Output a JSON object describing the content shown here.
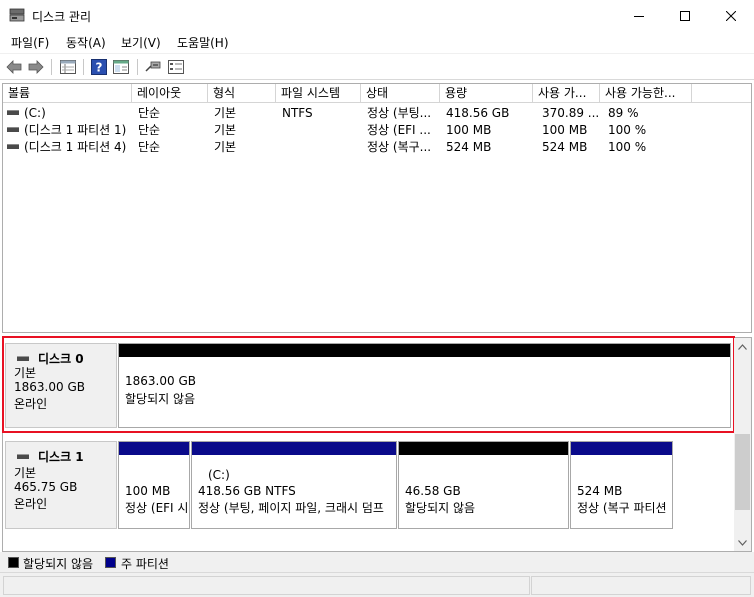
{
  "window": {
    "title": "디스크 관리",
    "controls": [
      "minimize-icon",
      "maximize-icon",
      "close-icon"
    ]
  },
  "menu": {
    "items": [
      {
        "label": "파일(F)"
      },
      {
        "label": "동작(A)"
      },
      {
        "label": "보기(V)"
      },
      {
        "label": "도움말(H)"
      }
    ]
  },
  "toolbar": {
    "icons": [
      "back-arrow-icon",
      "forward-arrow-icon",
      "volume-list-icon",
      "help-icon",
      "console-tree-icon",
      "connect-icon",
      "properties-icon"
    ]
  },
  "volume_table": {
    "columns": [
      "볼륨",
      "레이아웃",
      "형식",
      "파일 시스템",
      "상태",
      "용량",
      "사용 가...",
      "사용 가능한..."
    ],
    "rows": [
      {
        "volume": "(C:)",
        "layout": "단순",
        "type": "기본",
        "fs": "NTFS",
        "status": "정상 (부팅...",
        "capacity": "418.56 GB",
        "free": "370.89 ...",
        "pct": "89 %"
      },
      {
        "volume": "(디스크 1 파티션 1)",
        "layout": "단순",
        "type": "기본",
        "fs": "",
        "status": "정상 (EFI ...",
        "capacity": "100 MB",
        "free": "100 MB",
        "pct": "100 %"
      },
      {
        "volume": "(디스크 1 파티션 4)",
        "layout": "단순",
        "type": "기본",
        "fs": "",
        "status": "정상 (복구...",
        "capacity": "524 MB",
        "free": "524 MB",
        "pct": "100 %"
      }
    ]
  },
  "disks": [
    {
      "name": "디스크 0",
      "type": "기본",
      "size": "1863.00 GB",
      "status": "온라인",
      "partitions": [
        {
          "line1": "",
          "line2": "1863.00 GB",
          "line3": "할당되지 않음",
          "kind": "unallocated"
        }
      ]
    },
    {
      "name": "디스크 1",
      "type": "기본",
      "size": "465.75 GB",
      "status": "온라인",
      "partitions": [
        {
          "line1": "",
          "line2": "100 MB",
          "line3": "정상 (EFI 시",
          "kind": "primary"
        },
        {
          "line1": "(C:)",
          "line2": "418.56 GB NTFS",
          "line3": "정상 (부팅, 페이지 파일, 크래시 덤프",
          "kind": "primary"
        },
        {
          "line1": "",
          "line2": "46.58 GB",
          "line3": "할당되지 않음",
          "kind": "unallocated"
        },
        {
          "line1": "",
          "line2": "524 MB",
          "line3": "정상 (복구 파티션",
          "kind": "primary"
        }
      ]
    }
  ],
  "legend": [
    {
      "label": "할당되지 않음",
      "color": "#000000"
    },
    {
      "label": "주 파티션",
      "color": "#00008b"
    }
  ],
  "colors": {
    "unallocated": "#000000",
    "primary": "#0a0a8a",
    "selection_outline": "#e81123"
  }
}
